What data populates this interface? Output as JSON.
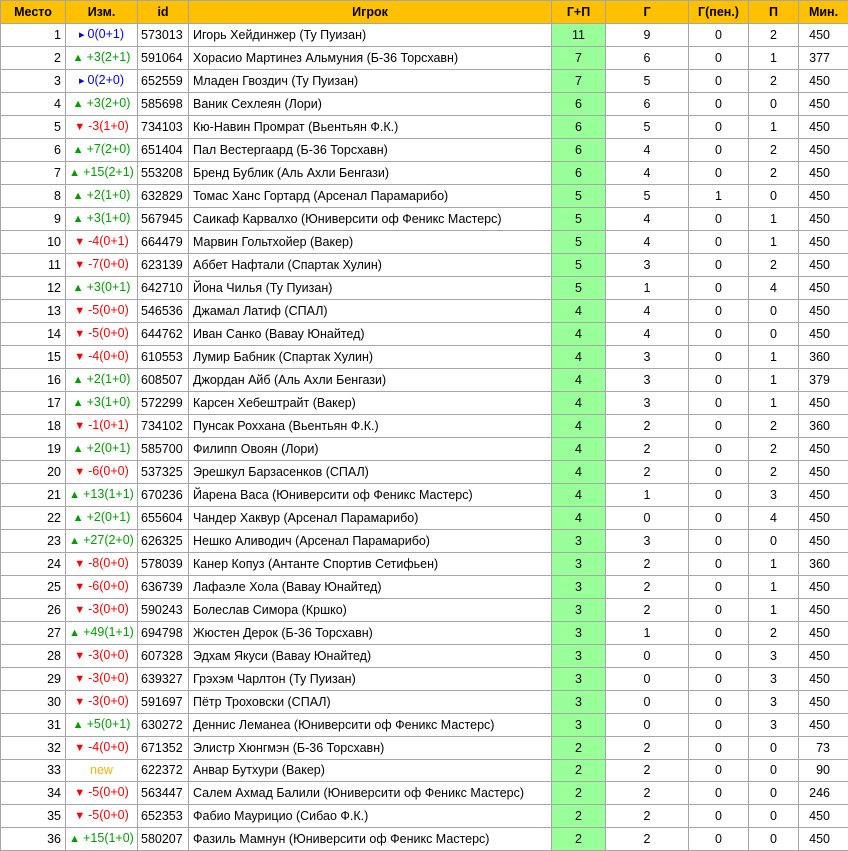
{
  "colors": {
    "header": "#ffc000",
    "gp_highlight": "#99ff99",
    "up": "#00a000",
    "down": "#ff0000",
    "same": "#0000ff",
    "new": "#ffb000"
  },
  "columns": [
    "Место",
    "Изм.",
    "id",
    "Игрок",
    "Г+П",
    "Г",
    "Г(пен.)",
    "П",
    "Мин."
  ],
  "rows": [
    {
      "place": "1",
      "dir": "same",
      "change": "0(0+1)",
      "id": "573013",
      "player": "Игорь Хейдинжер (Ту Пуизан)",
      "gp": "11",
      "g": "9",
      "gpen": "0",
      "a": "2",
      "min": "450"
    },
    {
      "place": "2",
      "dir": "up",
      "change": "+3(2+1)",
      "id": "591064",
      "player": "Хорасио Мартинез Альмуния (Б-36 Торсхавн)",
      "gp": "7",
      "g": "6",
      "gpen": "0",
      "a": "1",
      "min": "377"
    },
    {
      "place": "3",
      "dir": "same",
      "change": "0(2+0)",
      "id": "652559",
      "player": "Младен Гвоздич (Ту Пуизан)",
      "gp": "7",
      "g": "5",
      "gpen": "0",
      "a": "2",
      "min": "450"
    },
    {
      "place": "4",
      "dir": "up",
      "change": "+3(2+0)",
      "id": "585698",
      "player": "Ваник Сехлеян (Лори)",
      "gp": "6",
      "g": "6",
      "gpen": "0",
      "a": "0",
      "min": "450"
    },
    {
      "place": "5",
      "dir": "down",
      "change": "-3(1+0)",
      "id": "734103",
      "player": "Кю-Навин Промрат (Вьентьян Ф.К.)",
      "gp": "6",
      "g": "5",
      "gpen": "0",
      "a": "1",
      "min": "450"
    },
    {
      "place": "6",
      "dir": "up",
      "change": "+7(2+0)",
      "id": "651404",
      "player": "Пал Вестергаард (Б-36 Торсхавн)",
      "gp": "6",
      "g": "4",
      "gpen": "0",
      "a": "2",
      "min": "450"
    },
    {
      "place": "7",
      "dir": "up",
      "change": "+15(2+1)",
      "id": "553208",
      "player": "Бренд Бублик (Аль Ахли Бенгази)",
      "gp": "6",
      "g": "4",
      "gpen": "0",
      "a": "2",
      "min": "450"
    },
    {
      "place": "8",
      "dir": "up",
      "change": "+2(1+0)",
      "id": "632829",
      "player": "Томас Ханс Гортард (Арсенал Парамарибо)",
      "gp": "5",
      "g": "5",
      "gpen": "1",
      "a": "0",
      "min": "450"
    },
    {
      "place": "9",
      "dir": "up",
      "change": "+3(1+0)",
      "id": "567945",
      "player": "Саикаф Карвалхо (Юниверсити оф Феникс Мастерс)",
      "gp": "5",
      "g": "4",
      "gpen": "0",
      "a": "1",
      "min": "450"
    },
    {
      "place": "10",
      "dir": "down",
      "change": "-4(0+1)",
      "id": "664479",
      "player": "Марвин Гольтхойер (Вакер)",
      "gp": "5",
      "g": "4",
      "gpen": "0",
      "a": "1",
      "min": "450"
    },
    {
      "place": "11",
      "dir": "down",
      "change": "-7(0+0)",
      "id": "623139",
      "player": "Аббет Нафтали (Спартак Хулин)",
      "gp": "5",
      "g": "3",
      "gpen": "0",
      "a": "2",
      "min": "450"
    },
    {
      "place": "12",
      "dir": "up",
      "change": "+3(0+1)",
      "id": "642710",
      "player": "Йона Чилья (Ту Пуизан)",
      "gp": "5",
      "g": "1",
      "gpen": "0",
      "a": "4",
      "min": "450"
    },
    {
      "place": "13",
      "dir": "down",
      "change": "-5(0+0)",
      "id": "546536",
      "player": "Джамал Латиф (СПАЛ)",
      "gp": "4",
      "g": "4",
      "gpen": "0",
      "a": "0",
      "min": "450"
    },
    {
      "place": "14",
      "dir": "down",
      "change": "-5(0+0)",
      "id": "644762",
      "player": "Иван Санко (Вавау Юнайтед)",
      "gp": "4",
      "g": "4",
      "gpen": "0",
      "a": "0",
      "min": "450"
    },
    {
      "place": "15",
      "dir": "down",
      "change": "-4(0+0)",
      "id": "610553",
      "player": "Лумир Бабник (Спартак Хулин)",
      "gp": "4",
      "g": "3",
      "gpen": "0",
      "a": "1",
      "min": "360"
    },
    {
      "place": "16",
      "dir": "up",
      "change": "+2(1+0)",
      "id": "608507",
      "player": "Джордан Айб (Аль Ахли Бенгази)",
      "gp": "4",
      "g": "3",
      "gpen": "0",
      "a": "1",
      "min": "379"
    },
    {
      "place": "17",
      "dir": "up",
      "change": "+3(1+0)",
      "id": "572299",
      "player": "Карсен Хебештрайт (Вакер)",
      "gp": "4",
      "g": "3",
      "gpen": "0",
      "a": "1",
      "min": "450"
    },
    {
      "place": "18",
      "dir": "down",
      "change": "-1(0+1)",
      "id": "734102",
      "player": "Пунсак Роххана (Вьентьян Ф.К.)",
      "gp": "4",
      "g": "2",
      "gpen": "0",
      "a": "2",
      "min": "360"
    },
    {
      "place": "19",
      "dir": "up",
      "change": "+2(0+1)",
      "id": "585700",
      "player": "Филипп Овоян (Лори)",
      "gp": "4",
      "g": "2",
      "gpen": "0",
      "a": "2",
      "min": "450"
    },
    {
      "place": "20",
      "dir": "down",
      "change": "-6(0+0)",
      "id": "537325",
      "player": "Эрешкул Барзасенков (СПАЛ)",
      "gp": "4",
      "g": "2",
      "gpen": "0",
      "a": "2",
      "min": "450"
    },
    {
      "place": "21",
      "dir": "up",
      "change": "+13(1+1)",
      "id": "670236",
      "player": "Йарена Васа (Юниверсити оф Феникс Мастерс)",
      "gp": "4",
      "g": "1",
      "gpen": "0",
      "a": "3",
      "min": "450"
    },
    {
      "place": "22",
      "dir": "up",
      "change": "+2(0+1)",
      "id": "655604",
      "player": "Чандер Хаквур (Арсенал Парамарибо)",
      "gp": "4",
      "g": "0",
      "gpen": "0",
      "a": "4",
      "min": "450"
    },
    {
      "place": "23",
      "dir": "up",
      "change": "+27(2+0)",
      "id": "626325",
      "player": "Нешко Аливодич (Арсенал Парамарибо)",
      "gp": "3",
      "g": "3",
      "gpen": "0",
      "a": "0",
      "min": "450"
    },
    {
      "place": "24",
      "dir": "down",
      "change": "-8(0+0)",
      "id": "578039",
      "player": "Канер Копуз (Антанте Спортив Сетифьен)",
      "gp": "3",
      "g": "2",
      "gpen": "0",
      "a": "1",
      "min": "360"
    },
    {
      "place": "25",
      "dir": "down",
      "change": "-6(0+0)",
      "id": "636739",
      "player": "Лафаэле Хола (Вавау Юнайтед)",
      "gp": "3",
      "g": "2",
      "gpen": "0",
      "a": "1",
      "min": "450"
    },
    {
      "place": "26",
      "dir": "down",
      "change": "-3(0+0)",
      "id": "590243",
      "player": "Болеслав Симора (Кршко)",
      "gp": "3",
      "g": "2",
      "gpen": "0",
      "a": "1",
      "min": "450"
    },
    {
      "place": "27",
      "dir": "up",
      "change": "+49(1+1)",
      "id": "694798",
      "player": "Жюстен Дерок (Б-36 Торсхавн)",
      "gp": "3",
      "g": "1",
      "gpen": "0",
      "a": "2",
      "min": "450"
    },
    {
      "place": "28",
      "dir": "down",
      "change": "-3(0+0)",
      "id": "607328",
      "player": "Эдхам Якуси (Вавау Юнайтед)",
      "gp": "3",
      "g": "0",
      "gpen": "0",
      "a": "3",
      "min": "450"
    },
    {
      "place": "29",
      "dir": "down",
      "change": "-3(0+0)",
      "id": "639327",
      "player": "Грэхэм Чарлтон (Ту Пуизан)",
      "gp": "3",
      "g": "0",
      "gpen": "0",
      "a": "3",
      "min": "450"
    },
    {
      "place": "30",
      "dir": "down",
      "change": "-3(0+0)",
      "id": "591697",
      "player": "Пётр Троховски (СПАЛ)",
      "gp": "3",
      "g": "0",
      "gpen": "0",
      "a": "3",
      "min": "450"
    },
    {
      "place": "31",
      "dir": "up",
      "change": "+5(0+1)",
      "id": "630272",
      "player": "Деннис Леманеа (Юниверсити оф Феникс Мастерс)",
      "gp": "3",
      "g": "0",
      "gpen": "0",
      "a": "3",
      "min": "450"
    },
    {
      "place": "32",
      "dir": "down",
      "change": "-4(0+0)",
      "id": "671352",
      "player": "Элистр Хюнгмэн (Б-36 Торсхавн)",
      "gp": "2",
      "g": "2",
      "gpen": "0",
      "a": "0",
      "min": "73"
    },
    {
      "place": "33",
      "dir": "new",
      "change": "new",
      "id": "622372",
      "player": "Анвар Бутхури (Вакер)",
      "gp": "2",
      "g": "2",
      "gpen": "0",
      "a": "0",
      "min": "90"
    },
    {
      "place": "34",
      "dir": "down",
      "change": "-5(0+0)",
      "id": "563447",
      "player": "Салем Ахмад Балили (Юниверсити оф Феникс Мастерс)",
      "gp": "2",
      "g": "2",
      "gpen": "0",
      "a": "0",
      "min": "246"
    },
    {
      "place": "35",
      "dir": "down",
      "change": "-5(0+0)",
      "id": "652353",
      "player": "Фабио Маурицио (Сибао Ф.К.)",
      "gp": "2",
      "g": "2",
      "gpen": "0",
      "a": "0",
      "min": "450"
    },
    {
      "place": "36",
      "dir": "up",
      "change": "+15(1+0)",
      "id": "580207",
      "player": "Фазиль Мамнун (Юниверсити оф Феникс Мастерс)",
      "gp": "2",
      "g": "2",
      "gpen": "0",
      "a": "0",
      "min": "450"
    }
  ]
}
